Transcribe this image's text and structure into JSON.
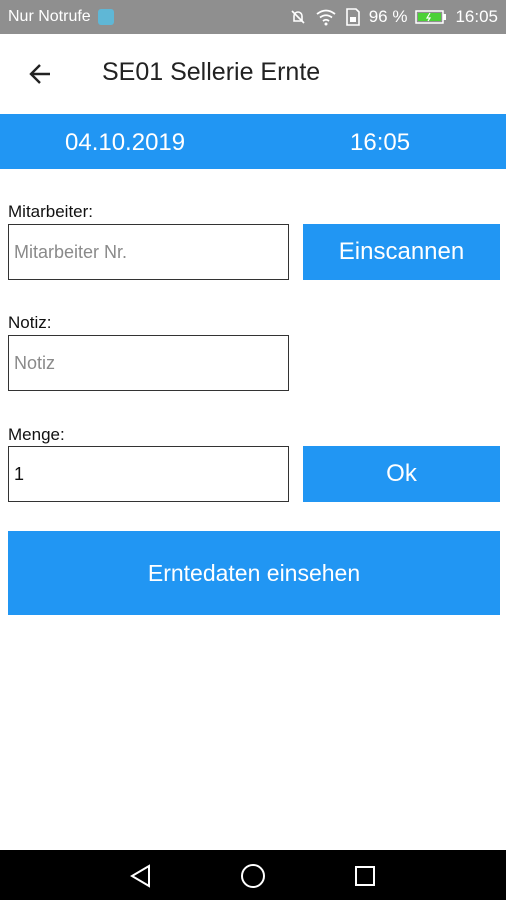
{
  "statusbar": {
    "carrier": "Nur Notrufe",
    "battery": "96 %",
    "time": "16:05",
    "icons": [
      "notification-icon",
      "mute-icon",
      "wifi-icon",
      "sim-icon",
      "battery-icon"
    ]
  },
  "appbar": {
    "title": "SE01 Sellerie Ernte",
    "back_icon": "arrow-left-icon"
  },
  "datebar": {
    "date": "04.10.2019",
    "time": "16:05"
  },
  "form": {
    "employee_label": "Mitarbeiter:",
    "employee_placeholder": "Mitarbeiter Nr.",
    "employee_value": "",
    "scan_button": "Einscannen",
    "note_label": "Notiz:",
    "note_placeholder": "Notiz",
    "note_value": "",
    "quantity_label": "Menge:",
    "quantity_value": "1",
    "ok_button": "Ok",
    "harvest_button": "Erntedaten einsehen"
  },
  "colors": {
    "accent": "#2196f3",
    "statusbar": "#8f8f8f",
    "navbar": "#000000"
  }
}
